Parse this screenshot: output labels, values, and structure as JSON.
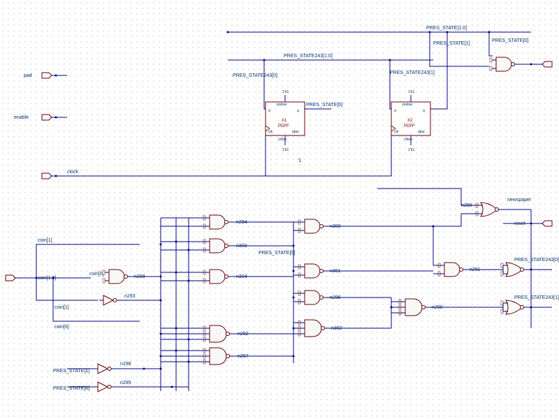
{
  "ports": {
    "pad": "pad",
    "enable": "enable",
    "clock": "clock",
    "coin_bus": "coin[1:0]",
    "coin1": "coin[1]",
    "coin0": "coin[0]",
    "coin1_b": "coin[1]",
    "coin0_b": "coin[0]",
    "newspaper": "newspaper",
    "reset": "reset"
  },
  "nets": {
    "ps_bus": "PRES_STATE[1:0]",
    "ps1": "PRES_STATE[1]",
    "ps0": "PRES_STATE[0]",
    "ps243_bus": "PRES_STATE243[1:0]",
    "ps243_1": "PRES_STATE243[1]",
    "ps243_0": "PRES_STATE243[0]",
    "n289": "n289",
    "n290": "n290",
    "n291": "n291",
    "n292": "n292",
    "n293": "n293",
    "n294": "n294",
    "n295": "n295",
    "n296": "n296",
    "n297": "n297",
    "n298": "n298",
    "n299": "n299",
    "n300": "n300",
    "n301": "n301",
    "n302": "n302",
    "n303": "n303",
    "n304": "n304",
    "ps0_net": "PRES_STATE[0]",
    "ps1_inv": "PRES_STATE[1]",
    "ps0_inv": "PRES_STATE[0]"
  },
  "flops": {
    "x1": {
      "name": "X1",
      "type": "PDFF",
      "d": "d",
      "q": "q",
      "clk": "clk",
      "qbar": "qbar",
      "prebar": "prebar",
      "clrbar": "clrbar",
      "tie": "1'b1"
    },
    "x2": {
      "name": "X2",
      "type": "PDFF",
      "d": "d",
      "q": "q",
      "clk": "clk",
      "qbar": "qbar",
      "prebar": "prebar",
      "clrbar": "clrbar",
      "tie": "1'b1"
    }
  },
  "const_one": "'1"
}
